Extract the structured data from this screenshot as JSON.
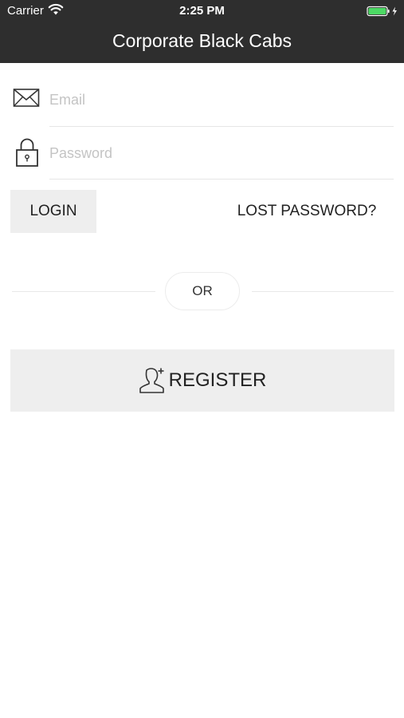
{
  "status_bar": {
    "carrier": "Carrier",
    "time": "2:25 PM",
    "battery_color": "#4cd964",
    "icons": [
      "wifi-icon",
      "battery-icon"
    ]
  },
  "header": {
    "title": "Corporate Black Cabs",
    "background": "#2e2e2e"
  },
  "login_form": {
    "email": {
      "placeholder": "Email",
      "value": "",
      "icon": "envelope-icon"
    },
    "password": {
      "placeholder": "Password",
      "value": "",
      "icon": "lock-icon"
    },
    "login_label": "LOGIN",
    "lost_password_label": "LOST PASSWORD?"
  },
  "divider": {
    "label": "OR"
  },
  "register": {
    "label": "REGISTER",
    "icon": "add-user-icon"
  }
}
